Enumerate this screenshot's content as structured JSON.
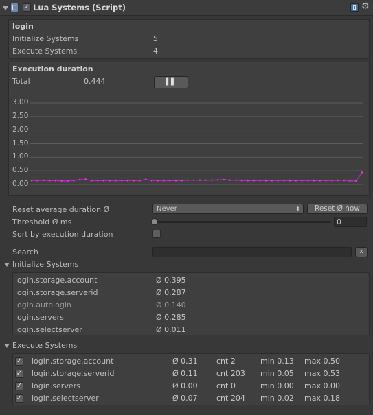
{
  "header": {
    "title": "Lua Systems (Script)"
  },
  "info": {
    "name": "login",
    "init_label": "Initialize Systems",
    "init_count": "5",
    "exec_label": "Execute Systems",
    "exec_count": "4"
  },
  "duration": {
    "title": "Execution duration",
    "total_label": "Total",
    "total_value": "0.444",
    "pause_glyph": "▌▌"
  },
  "chart_data": {
    "type": "line",
    "title": "",
    "xlabel": "",
    "ylabel": "",
    "ylim": [
      0,
      3.0
    ],
    "yticks": [
      "3.00",
      "2.50",
      "2.00",
      "1.50",
      "1.00",
      "0.50",
      "0.00"
    ],
    "grid": true,
    "color": "#c020c0",
    "values": [
      0.14,
      0.14,
      0.15,
      0.14,
      0.14,
      0.13,
      0.13,
      0.14,
      0.18,
      0.19,
      0.14,
      0.14,
      0.14,
      0.14,
      0.14,
      0.14,
      0.14,
      0.14,
      0.14,
      0.19,
      0.14,
      0.14,
      0.14,
      0.14,
      0.14,
      0.14,
      0.16,
      0.16,
      0.16,
      0.16,
      0.16,
      0.17,
      0.18,
      0.16,
      0.16,
      0.14,
      0.14,
      0.14,
      0.14,
      0.14,
      0.14,
      0.14,
      0.14,
      0.14,
      0.14,
      0.14,
      0.14,
      0.14,
      0.14,
      0.14,
      0.14,
      0.15,
      0.15,
      0.13,
      0.13,
      0.44
    ]
  },
  "settings": {
    "reset_label": "Reset average duration Ø",
    "reset_option": "Never",
    "reset_button": "Reset Ø now",
    "threshold_label": "Threshold Ø ms",
    "threshold_value": "0",
    "threshold_fraction": 0,
    "sort_label": "Sort by execution duration"
  },
  "search": {
    "label": "Search",
    "clear": "x",
    "value": ""
  },
  "init_section": {
    "title": "Initialize Systems",
    "rows": [
      {
        "name": "login.storage.account",
        "value": "Ø 0.395"
      },
      {
        "name": "login.storage.serverid",
        "value": "Ø 0.287"
      },
      {
        "name": "login.autologin",
        "value": "Ø 0.140"
      },
      {
        "name": "login.servers",
        "value": "Ø 0.285"
      },
      {
        "name": "login.selectserver",
        "value": "Ø 0.011"
      }
    ]
  },
  "exec_section": {
    "title": "Execute Systems",
    "rows": [
      {
        "name": "login.storage.account",
        "avg": "Ø 0.31",
        "cnt": "cnt 2",
        "min": "min 0.13",
        "max": "max 0.50"
      },
      {
        "name": "login.storage.serverid",
        "avg": "Ø 0.11",
        "cnt": "cnt 203",
        "min": "min 0.05",
        "max": "max 0.53"
      },
      {
        "name": "login.servers",
        "avg": "Ø 0.00",
        "cnt": "cnt 0",
        "min": "min 0.00",
        "max": "max 0.00"
      },
      {
        "name": "login.selectserver",
        "avg": "Ø 0.07",
        "cnt": "cnt 204",
        "min": "min 0.02",
        "max": "max 0.18"
      }
    ]
  }
}
